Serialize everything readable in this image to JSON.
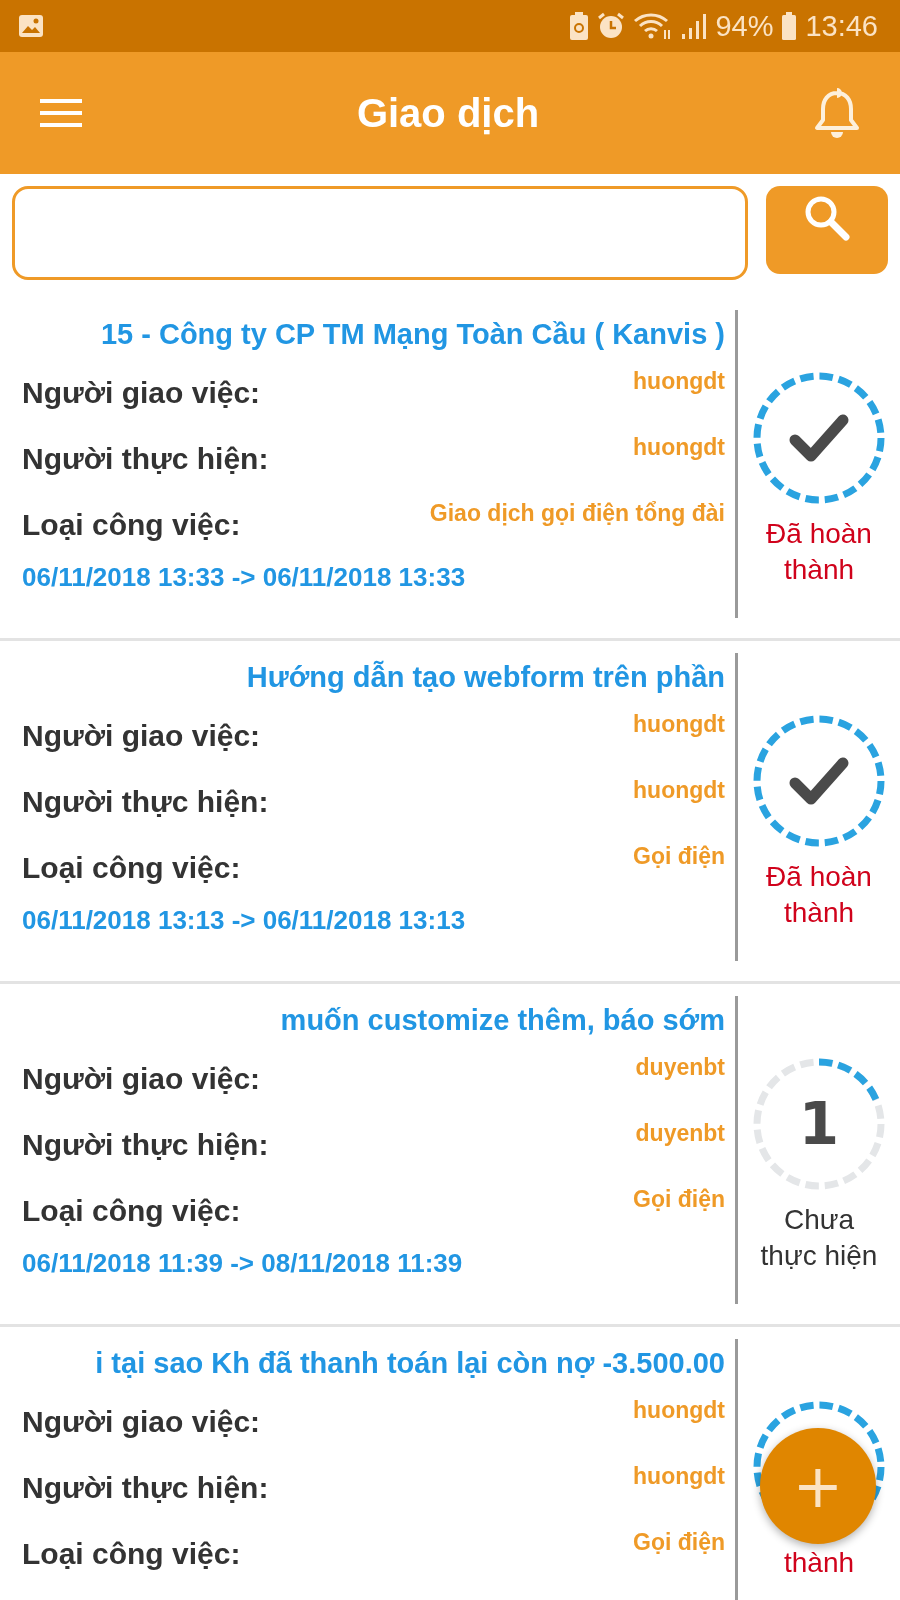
{
  "status_bar": {
    "battery": "94%",
    "time": "13:46"
  },
  "app_bar": {
    "title": "Giao dịch"
  },
  "cards": [
    {
      "title": "15 - Công ty CP TM Mạng Toàn Cầu ( Kanvis )",
      "fields": [
        {
          "label": "Người giao việc:",
          "value": "huongdt"
        },
        {
          "label": "Người thực hiện:",
          "value": "huongdt"
        },
        {
          "label": "Loại công việc:",
          "value": "Giao dịch gọi điện tổng đài"
        }
      ],
      "dates": "06/11/2018 13:33 -> 06/11/2018 13:33",
      "status": {
        "kind": "done",
        "text": "Đã hoàn thành"
      }
    },
    {
      "title": "Hướng dẫn tạo webform trên phần",
      "fields": [
        {
          "label": "Người giao việc:",
          "value": "huongdt"
        },
        {
          "label": "Người thực hiện:",
          "value": "huongdt"
        },
        {
          "label": "Loại công việc:",
          "value": "Gọi điện"
        }
      ],
      "dates": "06/11/2018 13:13 -> 06/11/2018 13:13",
      "status": {
        "kind": "done",
        "text": "Đã hoàn thành"
      }
    },
    {
      "title": "muốn customize thêm, báo sớm",
      "fields": [
        {
          "label": "Người giao việc:",
          "value": "duyenbt"
        },
        {
          "label": "Người thực hiện:",
          "value": "duyenbt"
        },
        {
          "label": "Loại công việc:",
          "value": "Gọi điện"
        }
      ],
      "dates": "06/11/2018 11:39 -> 08/11/2018 11:39",
      "status": {
        "kind": "pending",
        "count": "1",
        "level": 0.2,
        "text": "Chưa thực hiện"
      }
    },
    {
      "title": "i tại sao Kh đã thanh toán lại còn nợ -3.500.00",
      "fields": [
        {
          "label": "Người giao việc:",
          "value": "huongdt"
        },
        {
          "label": "Người thực hiện:",
          "value": "huongdt"
        },
        {
          "label": "Loại công việc:",
          "value": "Gọi điện"
        }
      ],
      "status": {
        "kind": "done",
        "text": "thành"
      }
    }
  ],
  "fab": {
    "label": "+"
  }
}
